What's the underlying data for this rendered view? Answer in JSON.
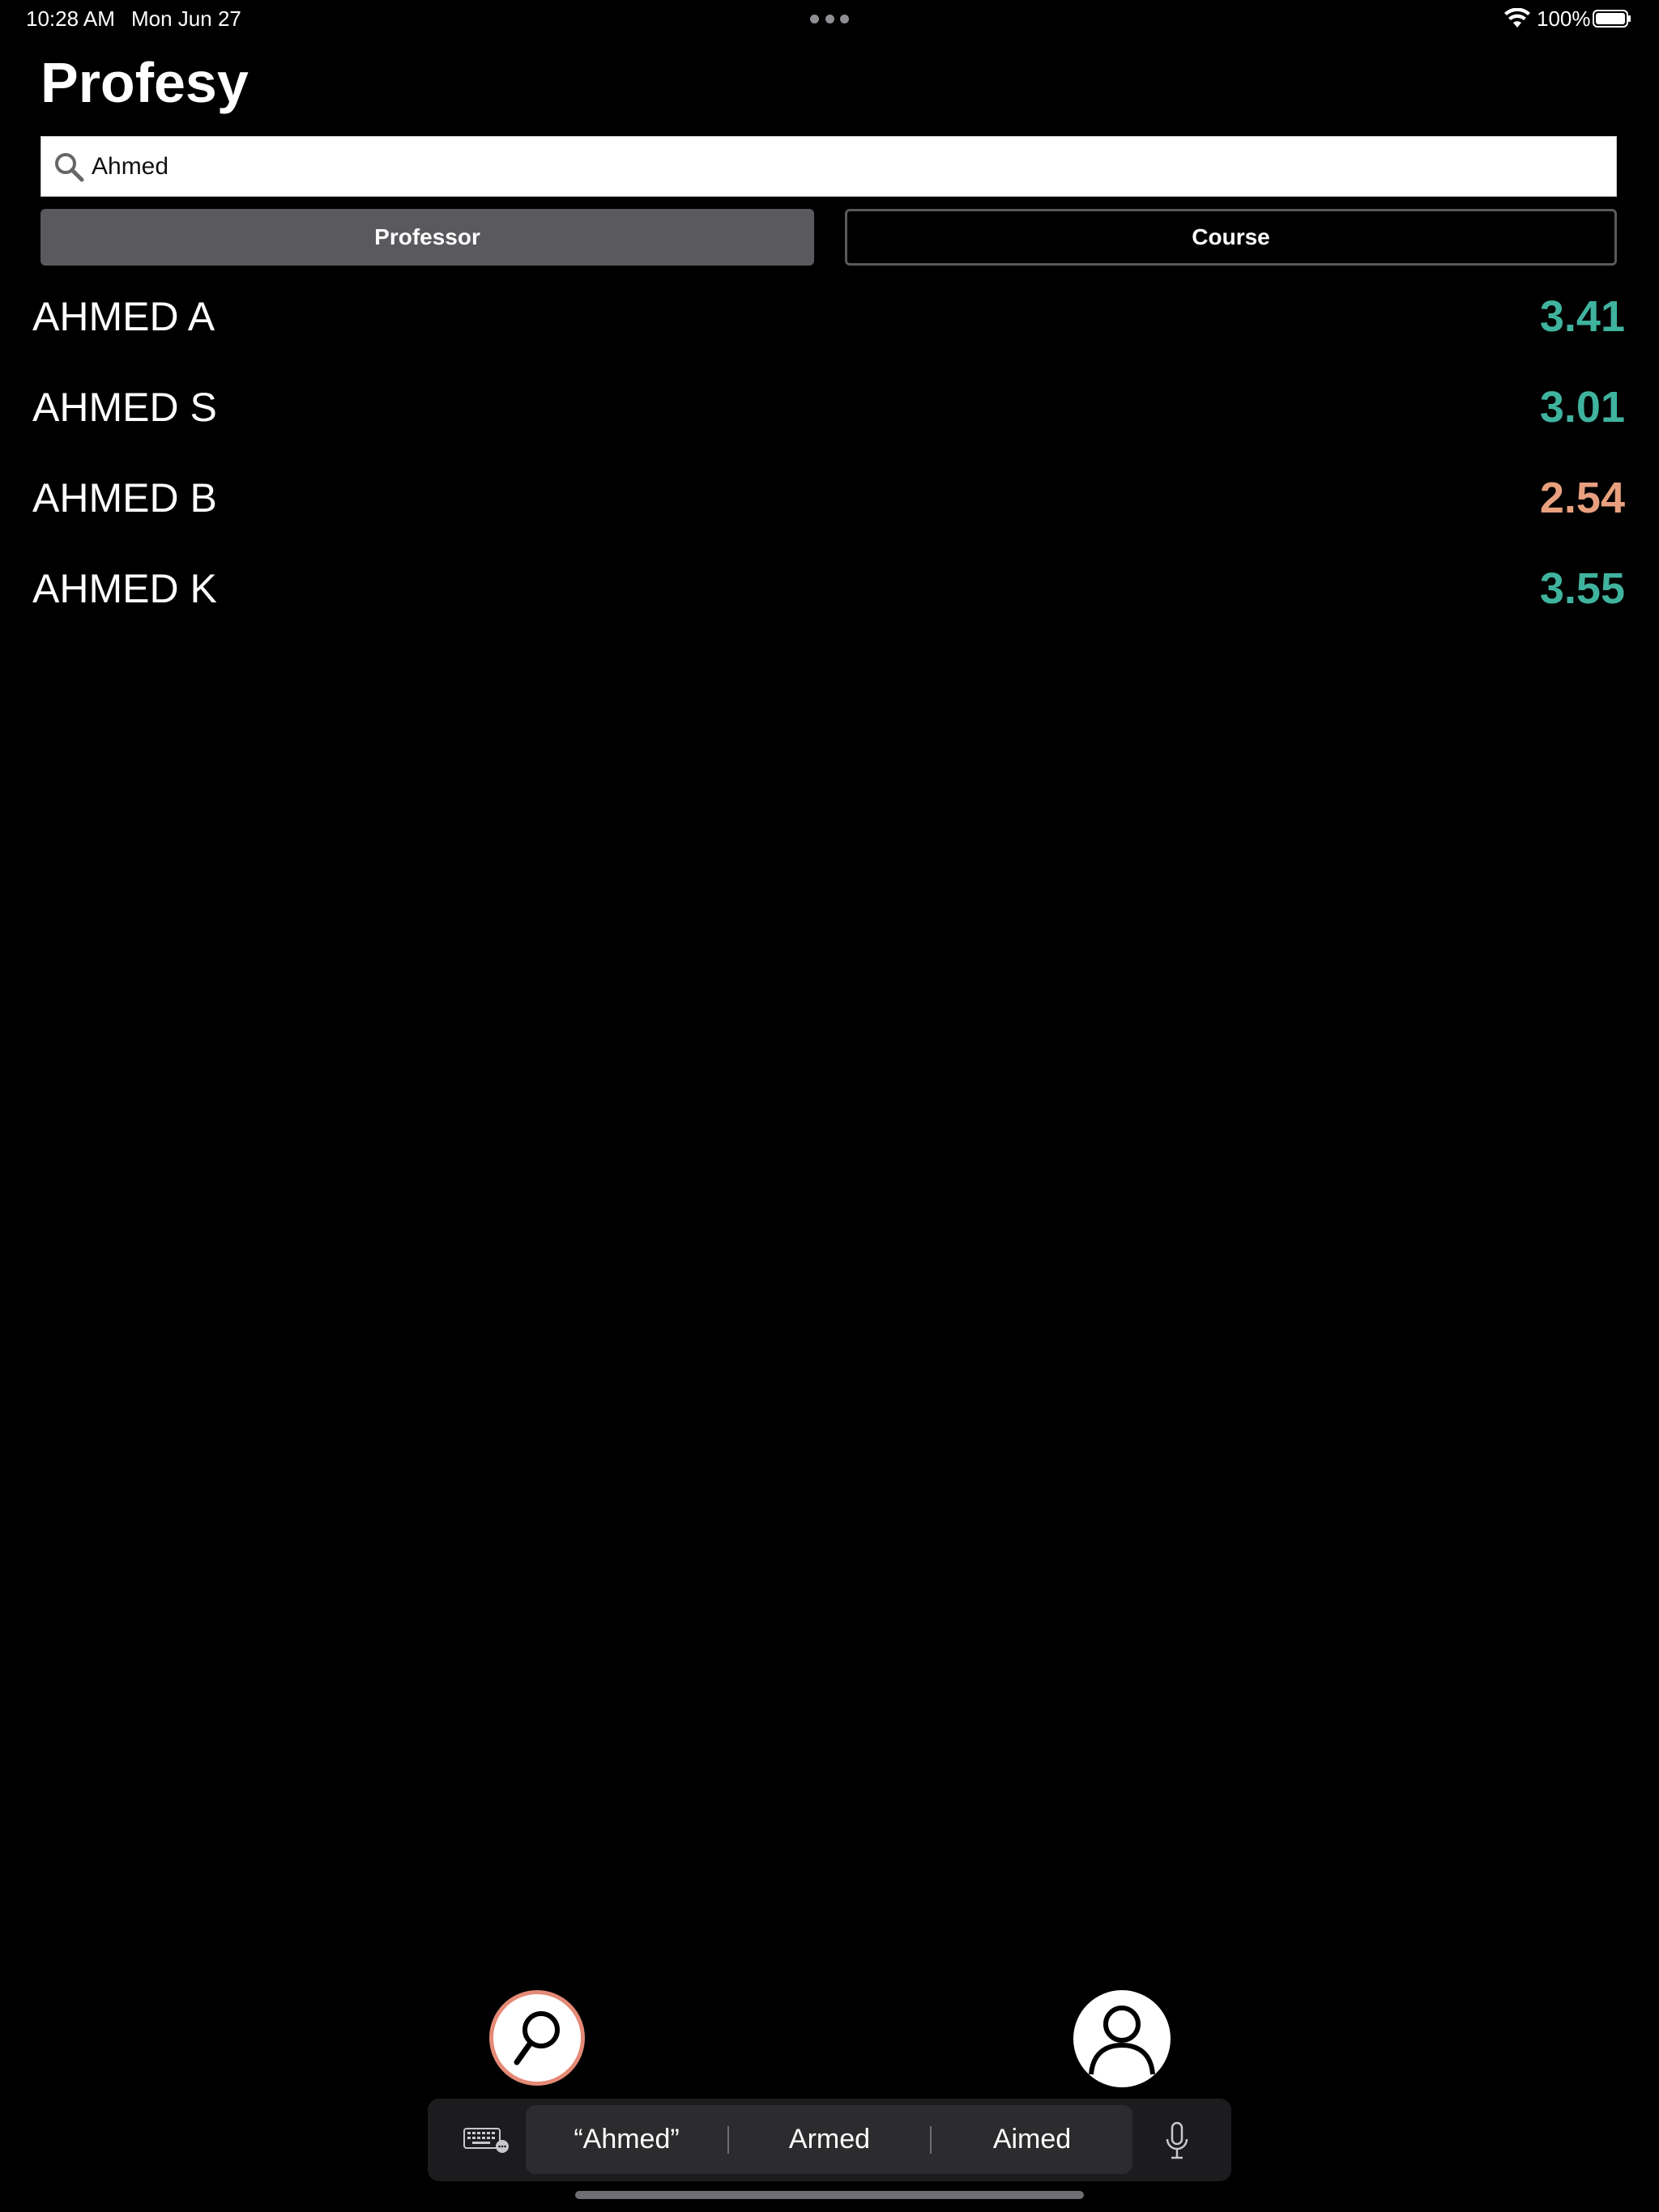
{
  "status_bar": {
    "time": "10:28 AM",
    "date": "Mon Jun 27",
    "battery": "100%"
  },
  "app": {
    "title": "Profesy"
  },
  "search": {
    "value": "Ahmed",
    "icon": "search-icon"
  },
  "segments": {
    "professor": "Professor",
    "course": "Course",
    "selected": "Professor"
  },
  "results": [
    {
      "name": "AHMED A",
      "score": "3.41",
      "color": "#3fb39e"
    },
    {
      "name": "AHMED S",
      "score": "3.01",
      "color": "#3fb39e"
    },
    {
      "name": "AHMED B",
      "score": "2.54",
      "color": "#e8a07e"
    },
    {
      "name": "AHMED K",
      "score": "3.55",
      "color": "#3fb39e"
    }
  ],
  "tabbar": {
    "search_icon": "magnifier-icon",
    "profile_icon": "person-icon",
    "active_ring_color": "#e48a76"
  },
  "quicktype": {
    "suggestions": [
      "“Ahmed”",
      "Armed",
      "Aimed"
    ]
  }
}
